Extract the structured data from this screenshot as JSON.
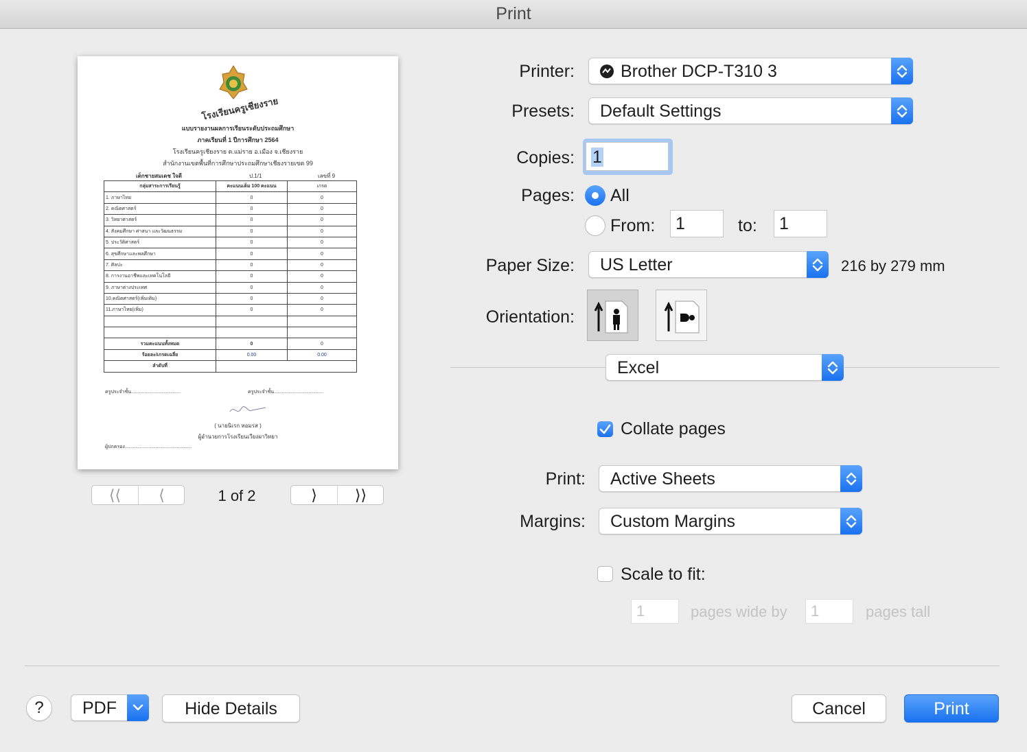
{
  "window": {
    "title": "Print"
  },
  "preview": {
    "school_name": "โรงเรียนครูเชียงราย",
    "report_title": "แบบรายงานผลการเรียนระดับประถมศึกษา",
    "semester": "ภาคเรียนที่ 1  ปีการศึกษา  2564",
    "address": "โรงเรียนครูเชียงราย  ต.แม่ราย  อ.เมือง  จ.เชียงราย",
    "office": "สำนักงานเขตพื้นที่การศึกษาประถมศึกษาเชียงรายเขต 99",
    "student": "เด็กชายสมเดช  ใจดี",
    "class": "ป.1/1",
    "number": "เลขที่  9",
    "table": {
      "headers": [
        "กลุ่มสาระการเรียนรู้",
        "คะแนนเต็ม 100 คะแนน",
        "เกรด"
      ],
      "rows": [
        [
          "1.  ภาษาไทย",
          "0",
          "0"
        ],
        [
          "2.  คณิตศาสตร์",
          "0",
          "0"
        ],
        [
          "3.  วิทยาศาสตร์",
          "0",
          "0"
        ],
        [
          "4.  สังคมศึกษา  ศาสนา และวัฒนธรรม",
          "0",
          "0"
        ],
        [
          "5.  ประวัติศาสตร์",
          "0",
          "0"
        ],
        [
          "6. สุขศึกษาและพลศึกษา",
          "0",
          "0"
        ],
        [
          "7.  ศิลปะ",
          "0",
          "0"
        ],
        [
          "8.  การงานอาชีพและเทคโนโลยี",
          "0",
          "0"
        ],
        [
          "9.  ภาษาต่างประเทศ",
          "0",
          "0"
        ],
        [
          "10.คณิตศาสตร์(เพิ่มเติม)",
          "0",
          "0"
        ],
        [
          "11.ภาษาไทย(เพิ่ม)",
          "0",
          "0"
        ],
        [
          "",
          "",
          ""
        ],
        [
          "",
          "",
          ""
        ]
      ],
      "total": [
        "รวมคะแนนทั้งหมด",
        "0",
        "0"
      ],
      "percent": [
        "ร้อยละ/เกรดเฉลี่ย",
        "0.00",
        "0.00"
      ],
      "rank": [
        "ลำดับที่",
        "",
        ""
      ]
    },
    "teacher1": "ครูประจำชั้น.....................................",
    "teacher2": "ครูประจำชั้น.....................................",
    "director_name": "(  นายนิเรก  หอมรส  )",
    "director_title": "ผู้อำนวยการโรงเรียนเวียงผาวิทยา",
    "parent": "ผู้ปกครอง..................................................",
    "page_indicator": "1 of 2"
  },
  "form": {
    "printer_label": "Printer:",
    "printer_value": "Brother DCP-T310 3",
    "presets_label": "Presets:",
    "presets_value": "Default Settings",
    "copies_label": "Copies:",
    "copies_value": "1",
    "pages_label": "Pages:",
    "pages_all": "All",
    "pages_from": "From:",
    "from_value": "1",
    "pages_to": "to:",
    "to_value": "1",
    "paper_label": "Paper Size:",
    "paper_value": "US Letter",
    "paper_dims": "216 by 279 mm",
    "orientation_label": "Orientation:",
    "app_section": "Excel",
    "collate_label": "Collate pages",
    "print_label": "Print:",
    "print_value": "Active Sheets",
    "margins_label": "Margins:",
    "margins_value": "Custom Margins",
    "scale_label": "Scale to fit:",
    "wide_value": "1",
    "wide_label": "pages wide by",
    "tall_value": "1",
    "tall_label": "pages tall"
  },
  "footer": {
    "help": "?",
    "pdf": "PDF",
    "hide_details": "Hide Details",
    "cancel": "Cancel",
    "print": "Print"
  },
  "colors": {
    "accent": "#1a72f0",
    "accent_light": "#5aa3fb",
    "background": "#ececec"
  }
}
